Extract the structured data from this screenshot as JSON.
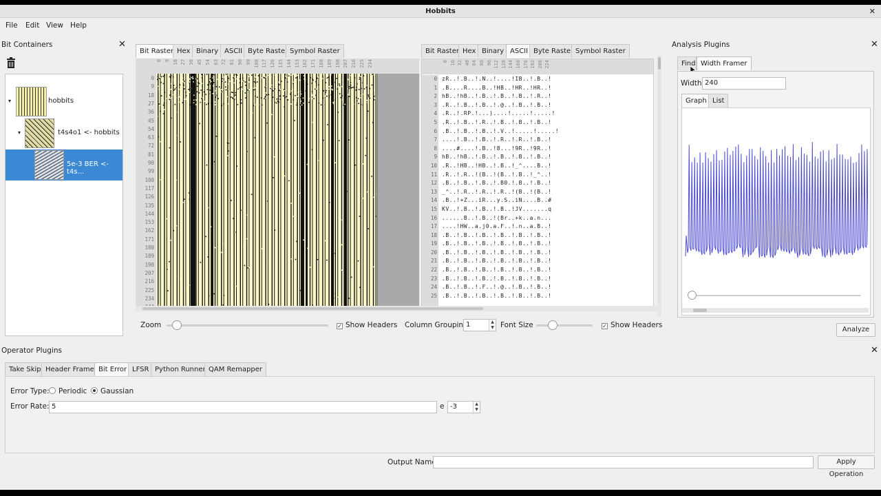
{
  "window": {
    "title": "Hobbits"
  },
  "menu": [
    "File",
    "Edit",
    "View",
    "Help"
  ],
  "bit_containers": {
    "title": "Bit Containers",
    "items": [
      {
        "label": "hobbits"
      },
      {
        "label": "t4s4o1 <- hobbits"
      },
      {
        "label": "5e-3 BER <- t4s..."
      }
    ]
  },
  "left_view": {
    "tabs": [
      "Bit Raster",
      "Hex",
      "Binary",
      "ASCII",
      "Byte Raster",
      "Symbol Raster"
    ],
    "active_tab": "Bit Raster",
    "row_headers": [
      "0",
      "9",
      "18",
      "27",
      "36",
      "45",
      "54",
      "63",
      "72",
      "81",
      "90",
      "99",
      "108",
      "117",
      "126",
      "135",
      "144",
      "153",
      "162",
      "171",
      "180",
      "189",
      "198",
      "207",
      "216",
      "225",
      "234",
      "243"
    ],
    "col_headers": [
      "0",
      "9",
      "18",
      "27",
      "36",
      "45",
      "54",
      "63",
      "72",
      "81",
      "90",
      "99",
      "108",
      "117",
      "126",
      "135",
      "144",
      "153",
      "162",
      "171",
      "180",
      "189",
      "198",
      "207",
      "216",
      "225",
      "234"
    ]
  },
  "right_view": {
    "tabs": [
      "Bit Raster",
      "Hex",
      "Binary",
      "ASCII",
      "Byte Raster",
      "Symbol Raster"
    ],
    "active_tab": "ASCII",
    "col_headers": [
      "0",
      "16",
      "32",
      "48",
      "64",
      "80",
      "96",
      "112",
      "128",
      "144",
      "160",
      "176",
      "192",
      "208",
      "224"
    ],
    "rows": [
      "zR..!.B..!.N..!....!IB..!.B..!",
      ".B....R....B..!HB..!HR..!HR..!",
      "hB..!hB..!.B..!.B..!.B..!.R..!",
      ".R..!.B..!.B..!.@..!.B..!.B..!",
      ".R..!.RP.!...)....!.....!.....!",
      ".R..!.B..!.R..!.B..!.B..!.B..!",
      ".B..!.B..!.B..!.V..!.....!.....!",
      "....!.B..!.B..!.R..!.R..!.B..!",
      "....#....!.B..!8...!9R..!9R..!",
      "hB..!hB..!.B..!.B..!.B..!.B..!",
      ".R..!HB..!HB..!.B..!_^....B..!",
      ".R..!.R..!(B..!(B..!.B..!_^..!",
      ".B..!.B..!.B..!.B0.!.B..!.B..!",
      "_^..!.R..!.R..!.R..!(B..!(B..!",
      ".B..!+Z...iR...y.S..iN....B..#",
      "KV..!.B..!.B..!.B..!JV.......q",
      "......B..!.B..!(Br..+k..a.n...",
      "....!HW..a.j0.a.F..!.n..a.B..!",
      ".B..!.B..!.B..!.B..!.B..!.B..!",
      ".B..!.B..!.B..!.B..!.B..!.B..!",
      ".B..!.B..!.B..!.B..!.B..!.B..!",
      ".B..!.B..!.B..!.B..!.B..!.B..!",
      ".B..!.B..!.B..!.B..!.B..!.B..!",
      ".B..!.B..!.B..!.B..!.B..!.B..!",
      ".B..!.B..!.F..!.@..!.B..!.B..!",
      ".B..!.B..!.B..!.B..!.B..!.B..!"
    ]
  },
  "view_controls": {
    "zoom_label": "Zoom",
    "show_headers_left": "Show Headers",
    "column_grouping_label": "Column Grouping",
    "column_grouping_value": "1",
    "font_size_label": "Font Size",
    "show_headers_right": "Show Headers"
  },
  "analysis": {
    "title": "Analysis Plugins",
    "tabs": [
      "Find",
      "Width Framer"
    ],
    "active_tab": "Width Framer",
    "width_label": "Width",
    "width_value": "240",
    "subtabs": [
      "Graph",
      "List"
    ],
    "active_subtab": "Graph",
    "analyze_label": "Analyze",
    "graph_color": "#4a4ad0"
  },
  "operator": {
    "title": "Operator Plugins",
    "tabs": [
      "Take Skip",
      "Header Framer",
      "Bit Error",
      "LFSR",
      "Python Runner",
      "QAM Remapper"
    ],
    "active_tab": "Bit Error",
    "error_type_label": "Error Type:",
    "options": [
      "Periodic",
      "Gaussian"
    ],
    "selected_option": "Gaussian",
    "error_rate_label": "Error Rate:",
    "error_rate_value": "5",
    "exponent_label": "e",
    "exponent_value": "-3",
    "output_name_label": "Output Name",
    "output_name_value": "",
    "apply_label": "Apply Operation"
  },
  "colors": {
    "selection": "#3b88d4",
    "raster_bg": "#fbf8c8",
    "graph_line": "#4a4ad0"
  }
}
